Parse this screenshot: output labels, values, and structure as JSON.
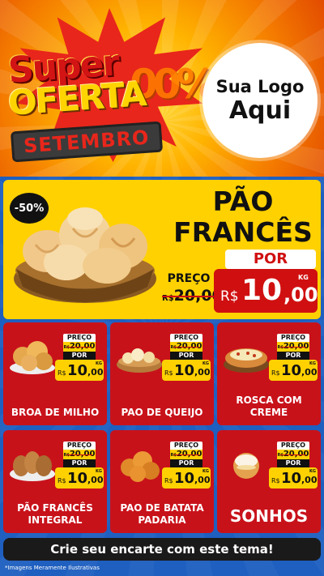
{
  "header": {
    "headline_super": "Super",
    "headline_oferta": "OFERTA",
    "headline_zeros": "00%",
    "month": "SETEMBRO",
    "logo_line1": "Sua Logo",
    "logo_line2": "Aqui"
  },
  "feature": {
    "discount": "-50%",
    "name_line1": "PÃO",
    "name_line2": "FRANCÊS",
    "old_label": "PREÇO",
    "old_currency": "R$",
    "old_value": "20,00",
    "por_label": "POR",
    "new_currency": "R$",
    "new_whole": "10",
    "new_cents": ",00",
    "unit": "KG"
  },
  "cards": [
    {
      "name": "BROA DE MILHO",
      "label": "PREÇO",
      "old_currency": "R$",
      "old_value": "20,00",
      "por": "POR",
      "currency": "R$",
      "whole": "10",
      "cents": ",00",
      "unit": "KG"
    },
    {
      "name": "PAO DE QUEIJO",
      "label": "PREÇO",
      "old_currency": "R$",
      "old_value": "20,00",
      "por": "POR",
      "currency": "R$",
      "whole": "10",
      "cents": ",00",
      "unit": "KG"
    },
    {
      "name": "ROSCA COM CREME",
      "label": "PREÇO",
      "old_currency": "R$",
      "old_value": "20,00",
      "por": "POR",
      "currency": "R$",
      "whole": "10",
      "cents": ",00",
      "unit": "KG"
    },
    {
      "name": "PÃO FRANCÊS INTEGRAL",
      "label": "PREÇO",
      "old_currency": "R$",
      "old_value": "20,00",
      "por": "POR",
      "currency": "R$",
      "whole": "10",
      "cents": ",00",
      "unit": "KG"
    },
    {
      "name": "PAO DE BATATA PADARIA",
      "label": "PREÇO",
      "old_currency": "R$",
      "old_value": "20,00",
      "por": "POR",
      "currency": "R$",
      "whole": "10",
      "cents": ",00",
      "unit": "KG"
    },
    {
      "name": "SONHOS",
      "label": "PREÇO",
      "old_currency": "R$",
      "old_value": "20,00",
      "por": "POR",
      "currency": "R$",
      "whole": "10",
      "cents": ",00",
      "unit": "KG"
    }
  ],
  "footer": {
    "cta": "Crie seu encarte com este tema!",
    "disclaimer": "*Imagens Meramente Ilustrativas"
  },
  "colors": {
    "red": "#c8121a",
    "yellow": "#ffd100",
    "blue": "#1e5fc0",
    "dark": "#1a1a1a"
  }
}
